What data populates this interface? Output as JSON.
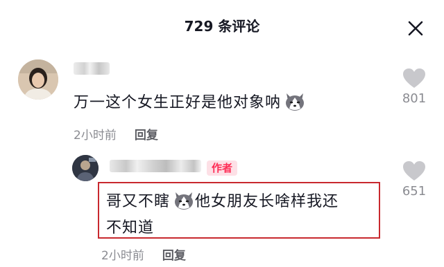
{
  "header": {
    "title": "729 条评论",
    "close_icon": "close-icon"
  },
  "comments": [
    {
      "text": "万一这个女生正好是他对象呐",
      "emoji": "husky-dog-emoji",
      "time": "2小时前",
      "reply_label": "回复",
      "likes": "801"
    }
  ],
  "reply": {
    "badge": "作者",
    "line1": "哥又不瞎",
    "line2": "他女朋友长啥样我还",
    "line3": "不知道",
    "emoji": "husky-dog-emoji",
    "time": "2小时前",
    "reply_label": "回复",
    "likes": "651"
  },
  "colors": {
    "accent": "#fe2c55",
    "highlight_box": "#c8282e",
    "muted": "#8a8b91"
  }
}
